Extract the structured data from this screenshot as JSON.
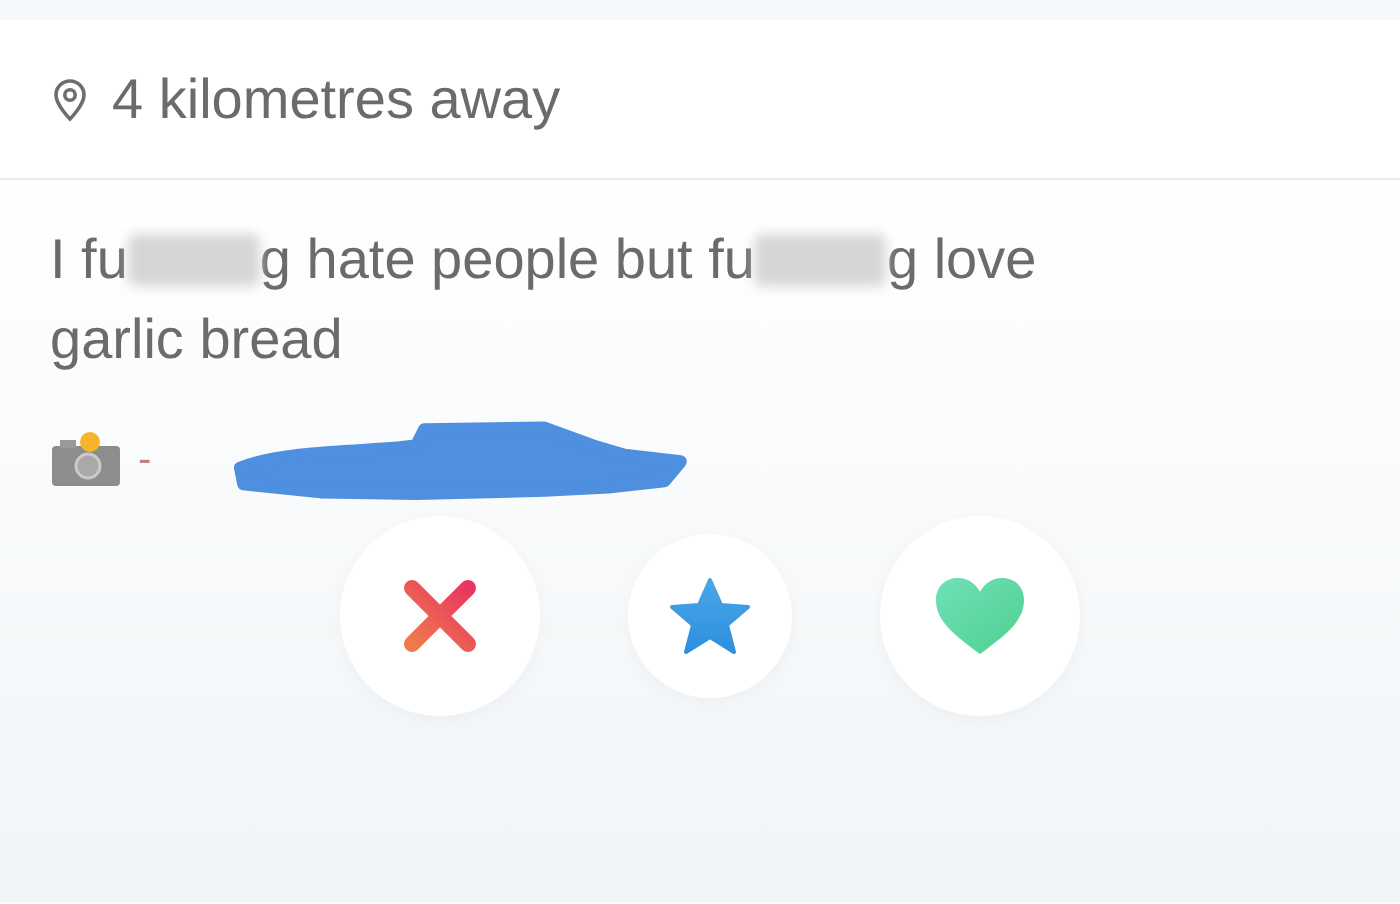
{
  "location": {
    "text": "4 kilometres away"
  },
  "bio": {
    "lines": [
      [
        {
          "kind": "text",
          "text": "I fu"
        },
        {
          "kind": "blur"
        },
        {
          "kind": "text",
          "text": "g hate people but fu"
        },
        {
          "kind": "blur"
        },
        {
          "kind": "text",
          "text": "g love"
        }
      ],
      [
        {
          "kind": "text",
          "text": "garlic bread"
        }
      ]
    ]
  },
  "photo_credit": {
    "separator": "-"
  },
  "actions": [
    {
      "kind": "nope"
    },
    {
      "kind": "super_like"
    },
    {
      "kind": "like"
    }
  ]
}
